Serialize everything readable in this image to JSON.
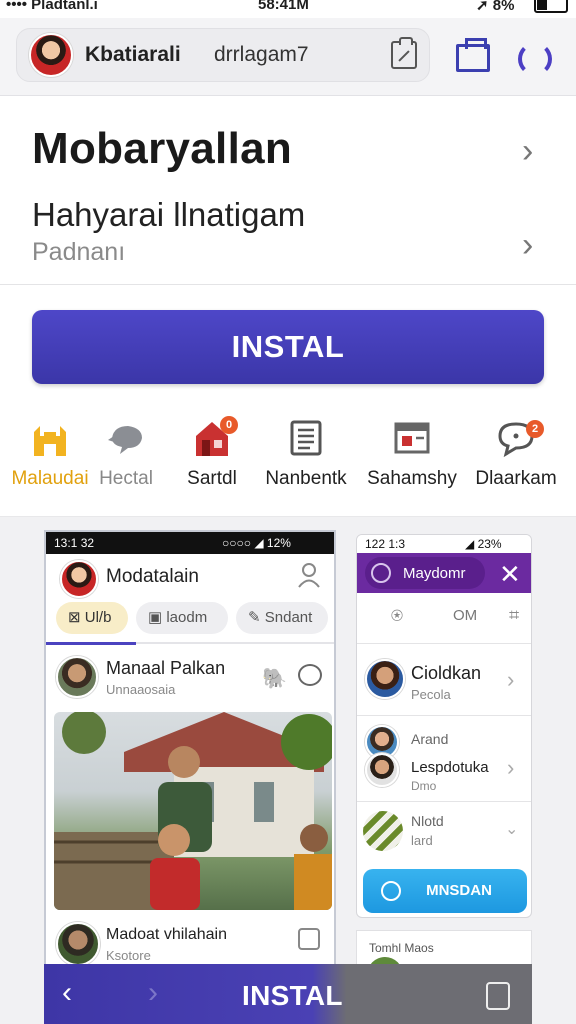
{
  "status_bar": {
    "carrier": "•••• Pladtanl.i",
    "time": "58:41M",
    "battery": "8%"
  },
  "top_bar": {
    "title": "Kbatiarali",
    "subtitle": "drrlagam7"
  },
  "list": {
    "row1_title": "Mobaryallan",
    "row2_title": "Hahyarai llnatigam",
    "row2_sub": "Padnanı"
  },
  "install_label": "INSTAL",
  "categories": [
    {
      "label": "Malaudai",
      "icon": "home-icon",
      "color": "#f2b320"
    },
    {
      "label": "Hectal",
      "icon": "speech-bird-icon",
      "color": "#8b8e94"
    },
    {
      "label": "Sartdl",
      "icon": "house-store-icon",
      "color": "#c93131",
      "badge": "0"
    },
    {
      "label": "Nanbentk",
      "icon": "document-icon",
      "color": "#555"
    },
    {
      "label": "Sahamshy",
      "icon": "window-icon",
      "color": "#666"
    },
    {
      "label": "Dlaarkam",
      "icon": "chat-bubble-icon",
      "color": "#555",
      "badge": "2"
    }
  ],
  "preview1": {
    "status_time": "13:1 32",
    "status_right": "○○○○ ◢ 12%",
    "title": "Modatalain",
    "chips": [
      "Ul/b",
      "laodm",
      "Sndant"
    ],
    "post_name": "Manaal Palkan",
    "post_sub": "Unnaaosaia",
    "footer_name": "Madoat vhilahain",
    "footer_sub": "Ksotore"
  },
  "preview2": {
    "status_time": "122 1:3",
    "status_right": "◢ 23%",
    "header": "Maydomr",
    "tabs": [
      "OM"
    ],
    "items": [
      {
        "name": "Cioldkan",
        "sub": "Pecola"
      },
      {
        "name": "Arand",
        "sub": ""
      },
      {
        "name": "Lespdotuka",
        "sub": "Dmo"
      },
      {
        "name": "Nlotd",
        "sub": "lard"
      }
    ],
    "cta": "MNSDAN"
  },
  "preview3": {
    "label": "Tomhl Maos"
  },
  "bottom_bar": {
    "label": "INSTAL"
  }
}
